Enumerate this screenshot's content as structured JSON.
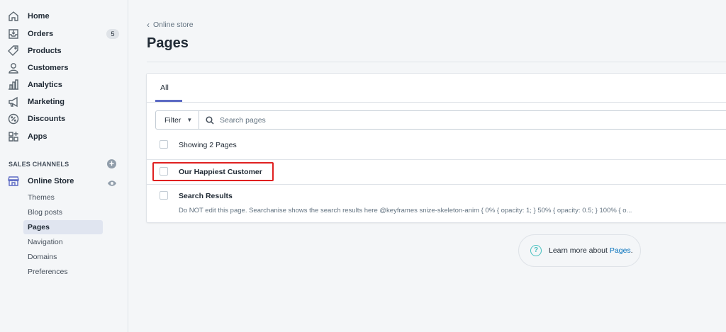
{
  "sidebar": {
    "items": [
      {
        "label": "Home",
        "icon": "home-icon"
      },
      {
        "label": "Orders",
        "icon": "orders-icon",
        "badge": "5"
      },
      {
        "label": "Products",
        "icon": "products-icon"
      },
      {
        "label": "Customers",
        "icon": "customers-icon"
      },
      {
        "label": "Analytics",
        "icon": "analytics-icon"
      },
      {
        "label": "Marketing",
        "icon": "marketing-icon"
      },
      {
        "label": "Discounts",
        "icon": "discounts-icon"
      },
      {
        "label": "Apps",
        "icon": "apps-icon"
      }
    ],
    "sales_channels_title": "SALES CHANNELS",
    "online_store": "Online Store",
    "sub_items": [
      "Themes",
      "Blog posts",
      "Pages",
      "Navigation",
      "Domains",
      "Preferences"
    ],
    "active_sub_item": "Pages"
  },
  "header": {
    "breadcrumb": "Online store",
    "title": "Pages"
  },
  "card": {
    "tab_all": "All",
    "filter_label": "Filter",
    "search_placeholder": "Search pages",
    "showing": "Showing 2 Pages",
    "rows": [
      {
        "title": "Our Happiest Customer",
        "subtitle": ""
      },
      {
        "title": "Search Results",
        "subtitle": "Do NOT edit this page. Searchanise shows the search results here @keyframes snize-skeleton-anim { 0% { opacity: 1; } 50% { opacity: 0.5; } 100% { o..."
      }
    ]
  },
  "help": {
    "text": "Learn more about",
    "link": "Pages",
    "suffix": "."
  },
  "colors": {
    "accent": "#5c6ac4",
    "highlight": "#e02020",
    "link": "#006fbb",
    "help_icon": "#47c1bf"
  }
}
